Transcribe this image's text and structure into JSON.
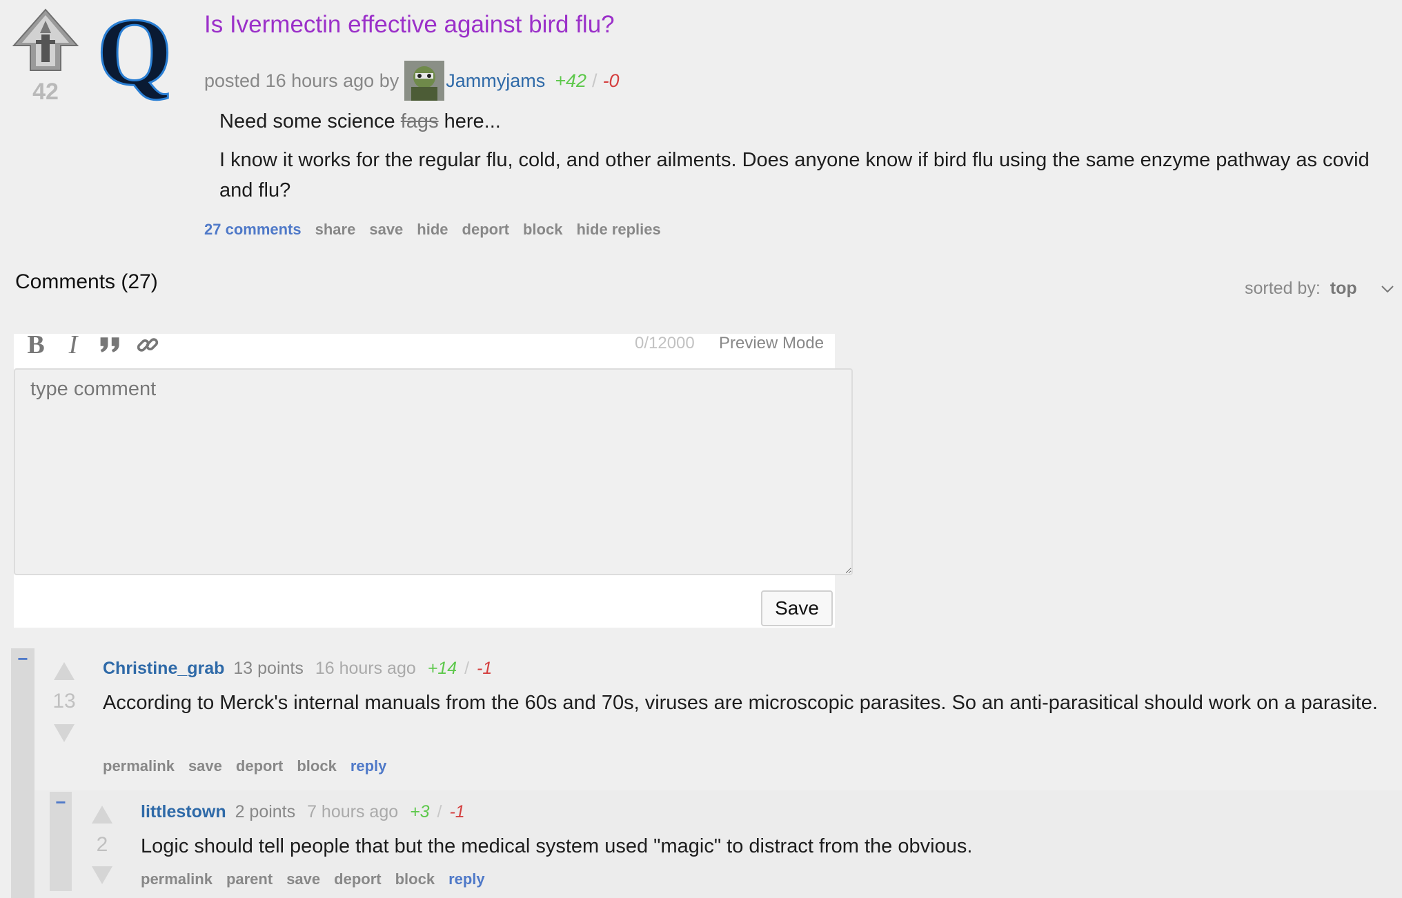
{
  "post": {
    "score": "42",
    "title": "Is Ivermectin effective against bird flu?",
    "posted_prefix": "posted 16 hours ago by",
    "author": "Jammyjams",
    "upvotes": "+42",
    "divider": "/",
    "downvotes": "-0",
    "body_line1_before": "Need some science",
    "body_line1_struck": "fags",
    "body_line1_after": "here...",
    "body_line2": "I know it works for the regular flu, cold, and other ailments. Does anyone know if bird flu using the same enzyme pathway as covid and flu?",
    "actions": {
      "comments": "27 comments",
      "share": "share",
      "save": "save",
      "hide": "hide",
      "deport": "deport",
      "block": "block",
      "hide_replies": "hide replies"
    },
    "thumbnail_letter": "Q"
  },
  "comments_section": {
    "heading": "Comments (27)",
    "sort_label": "sorted by:",
    "sort_value": "top"
  },
  "editor": {
    "toolbar": [
      "bold-icon",
      "italic-icon",
      "quote-icon",
      "link-icon"
    ],
    "char_count": "0/12000",
    "preview_label": "Preview Mode",
    "placeholder": "type comment",
    "save_label": "Save"
  },
  "comments": [
    {
      "collapse": "−",
      "score": "13",
      "author": "Christine_grab",
      "points": "13 points",
      "time": "16 hours ago",
      "upvotes": "+14",
      "divider": "/",
      "downvotes": "-1",
      "body": "According to Merck's internal manuals from the 60s and 70s, viruses are microscopic parasites. So an anti-parasitical should work on a parasite.",
      "actions": {
        "permalink": "permalink",
        "save": "save",
        "deport": "deport",
        "block": "block",
        "reply": "reply"
      }
    },
    {
      "collapse": "−",
      "score": "2",
      "author": "littlestown",
      "points": "2 points",
      "time": "7 hours ago",
      "upvotes": "+3",
      "divider": "/",
      "downvotes": "-1",
      "body": "Logic should tell people that but the medical system used \"magic\" to distract from the obvious.",
      "actions": {
        "permalink": "permalink",
        "parent": "parent",
        "save": "save",
        "deport": "deport",
        "block": "block",
        "reply": "reply"
      }
    }
  ],
  "colors": {
    "title": "#9b30c9",
    "link": "#2f6aa8",
    "accent": "#4f79c8",
    "upvote": "#5dc84b",
    "downvote": "#d43f3f",
    "background": "#efefef"
  }
}
